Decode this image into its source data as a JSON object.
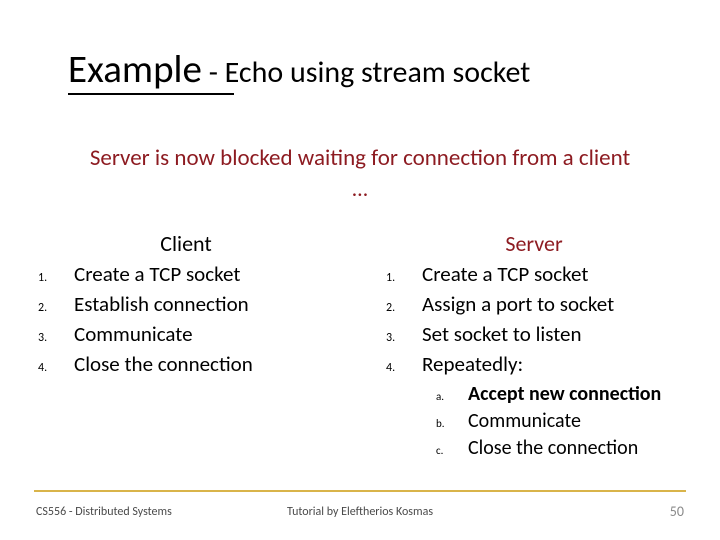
{
  "title": {
    "main": "Example",
    "sub": " - Echo using stream socket"
  },
  "subtitle": {
    "line": "Server is now blocked waiting for connection from a client",
    "dots": "…"
  },
  "client": {
    "heading": "Client",
    "steps": [
      {
        "n": "1.",
        "text": "Create a TCP socket"
      },
      {
        "n": "2.",
        "text": "Establish connection"
      },
      {
        "n": "3.",
        "text": "Communicate"
      },
      {
        "n": "4.",
        "text": "Close the connection"
      }
    ]
  },
  "server": {
    "heading": "Server",
    "steps": [
      {
        "n": "1.",
        "text": "Create a TCP socket"
      },
      {
        "n": "2.",
        "text": "Assign a port to socket"
      },
      {
        "n": "3.",
        "text": "Set socket to listen"
      },
      {
        "n": "4.",
        "text": "Repeatedly:"
      }
    ],
    "substeps": [
      {
        "n": "a.",
        "text": "Accept new connection",
        "bold": true
      },
      {
        "n": "b.",
        "text": "Communicate",
        "bold": false
      },
      {
        "n": "c.",
        "text": "Close the connection",
        "bold": false
      }
    ]
  },
  "footer": {
    "left": "CS556 - Distributed Systems",
    "center": "Tutorial by Eleftherios Kosmas",
    "right": "50"
  }
}
